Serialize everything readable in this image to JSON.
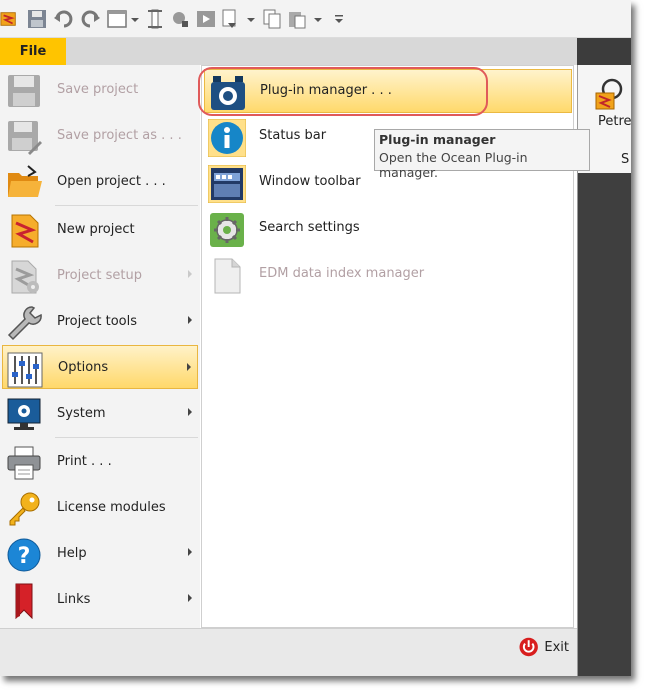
{
  "quick_access": {
    "icons": [
      "petrel-logo-icon",
      "save-icon",
      "undo-icon",
      "redo-icon",
      "window-icon",
      "dropdown-icon",
      "ruler-icon",
      "tools-icon",
      "play-icon",
      "workflow-icon",
      "dropdown-icon",
      "copy-icon",
      "paste-icon",
      "dropdown-icon",
      "customize-icon"
    ]
  },
  "tabs": {
    "file_label": "File"
  },
  "ribbon": {
    "petrel_label": "Petre",
    "s_label": "S"
  },
  "left_menu": [
    {
      "label": "Save project",
      "icon": "save-icon",
      "disabled": true,
      "submenu": false
    },
    {
      "label": "Save project as . . .",
      "icon": "save-as-icon",
      "disabled": true,
      "submenu": false
    },
    {
      "label": "Open project . . .",
      "icon": "open-folder-icon",
      "disabled": false,
      "submenu": false
    },
    {
      "label": "New project",
      "icon": "new-project-icon",
      "disabled": false,
      "submenu": false
    },
    {
      "label": "Project setup",
      "icon": "project-setup-icon",
      "disabled": true,
      "submenu": true
    },
    {
      "label": "Project tools",
      "icon": "wrench-icon",
      "disabled": false,
      "submenu": true
    },
    {
      "label": "Options",
      "icon": "sliders-icon",
      "disabled": false,
      "submenu": true,
      "selected": true
    },
    {
      "label": "System",
      "icon": "monitor-gear-icon",
      "disabled": false,
      "submenu": true
    },
    {
      "label": "Print . . .",
      "icon": "printer-icon",
      "disabled": false,
      "submenu": false
    },
    {
      "label": "License modules",
      "icon": "key-icon",
      "disabled": false,
      "submenu": false
    },
    {
      "label": "Help",
      "icon": "help-icon",
      "disabled": false,
      "submenu": true
    },
    {
      "label": "Links",
      "icon": "bookmark-icon",
      "disabled": false,
      "submenu": true
    }
  ],
  "options_submenu": [
    {
      "label": "Plug-in manager . . .",
      "icon": "plugin-manager-icon",
      "highlighted": true,
      "disabled": false
    },
    {
      "label": "Status bar",
      "icon": "info-icon",
      "highlighted": false,
      "disabled": false
    },
    {
      "label": "Window toolbar",
      "icon": "window-toolbar-icon",
      "highlighted": false,
      "disabled": false
    },
    {
      "label": "Search settings",
      "icon": "gear-icon",
      "highlighted": false,
      "disabled": false
    },
    {
      "label": "EDM data index manager",
      "icon": "document-icon",
      "highlighted": false,
      "disabled": true
    }
  ],
  "tooltip": {
    "title": "Plug-in manager",
    "description": "Open the Ocean Plug-in manager."
  },
  "footer": {
    "exit_label": "Exit",
    "exit_icon": "power-icon"
  },
  "colors": {
    "file_tab": "#ffc400",
    "highlight": "#ffd96b",
    "callout": "#e05a5a",
    "exit_red": "#d81e1e"
  }
}
